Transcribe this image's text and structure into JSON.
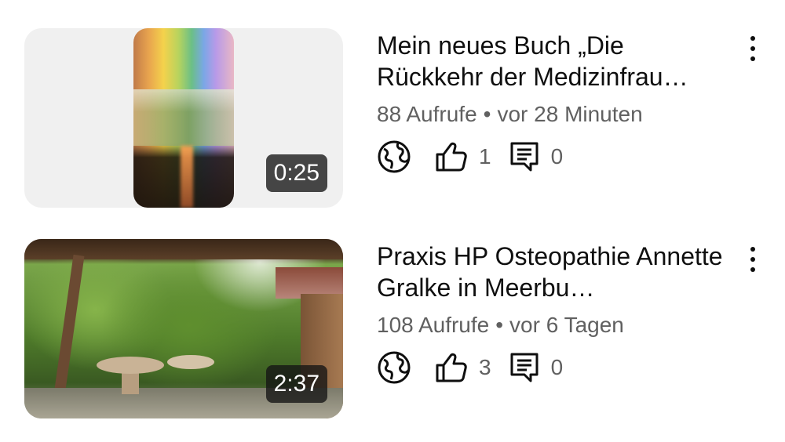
{
  "videos": [
    {
      "title": "Mein neues Buch „Die Rückkehr der Medizinfrau…",
      "views": "88 Aufrufe",
      "separator": "•",
      "age": "vor 28 Minuten",
      "duration": "0:25",
      "likes": "1",
      "comments": "0",
      "visibility_icon": "globe-icon",
      "like_icon": "thumbs-up-icon",
      "comment_icon": "comment-icon",
      "menu_icon": "more-vert-icon"
    },
    {
      "title": "Praxis HP Osteopathie Annette Gralke in Meerbu…",
      "views": "108 Aufrufe",
      "separator": "•",
      "age": "vor 6 Tagen",
      "duration": "2:37",
      "likes": "3",
      "comments": "0",
      "visibility_icon": "globe-icon",
      "like_icon": "thumbs-up-icon",
      "comment_icon": "comment-icon",
      "menu_icon": "more-vert-icon"
    }
  ]
}
